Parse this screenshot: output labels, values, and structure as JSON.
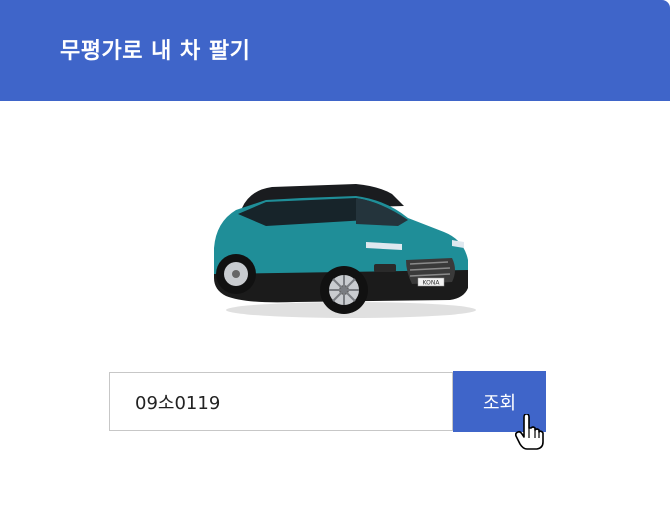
{
  "header": {
    "title": "무평가로 내 차 팔기"
  },
  "car_image": {
    "icon": "suv-car-image",
    "badge_text": "KONA",
    "body_color": "#1f8e98"
  },
  "search": {
    "value": "09소0119",
    "button_label": "조회"
  },
  "colors": {
    "accent": "#3f65c9"
  }
}
